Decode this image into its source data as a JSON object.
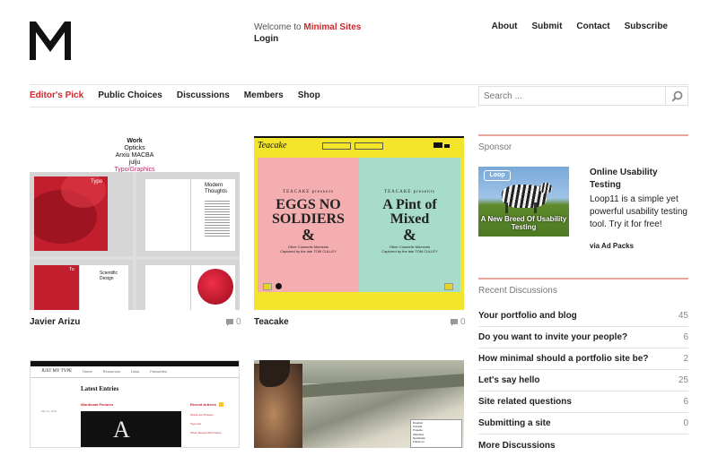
{
  "header": {
    "welcome_prefix": "Welcome to",
    "brand": "Minimal Sites",
    "login": "Login",
    "topnav": [
      "About",
      "Submit",
      "Contact",
      "Subscribe"
    ]
  },
  "mainnav": [
    "Editor's Pick",
    "Public Choices",
    "Discussions",
    "Members",
    "Shop"
  ],
  "search": {
    "placeholder": "Search ..."
  },
  "sites": [
    {
      "title": "Javier Arizu",
      "comments": "0",
      "preview_lines": [
        "Work",
        "Opticks",
        "Arxiu MACBA",
        "julju",
        "Typo/Graphics"
      ],
      "preview_panels": [
        "Typo",
        "Modern Thoughts",
        "Tu",
        "Scientific Design"
      ]
    },
    {
      "title": "Teacake",
      "comments": "0",
      "preview_logo": "Teacake",
      "preview_left": {
        "kicker": "TEACAKE presents",
        "title": "EGGS NO SOLDIERS",
        "amp": "&",
        "sub1": "Other Cosmetic Moments",
        "sub2": "Captured by the late TOM CULLEY"
      },
      "preview_right": {
        "kicker": "TEACAKE presents",
        "title": "A Pint of Mixed",
        "amp": "&",
        "sub1": "Other Cosmetic Moments",
        "sub2": "Captured by the late TOM CULLEY"
      }
    },
    {
      "title": "",
      "preview_brand": "JUST MY TYPE",
      "preview_heading": "Latest Entries",
      "preview_tabs": [
        "Home",
        "Resources",
        "Links",
        "Favourites"
      ],
      "preview_post": "Wordicam Pictures",
      "preview_post_date": "Mar 11, 2011",
      "preview_side_head": "Recent Articles",
      "preview_side_items": [
        "Words are Pictures",
        "Type Cut",
        "Other Stamps Who Cares"
      ]
    },
    {
      "title": "",
      "preview_menu": [
        "Dreipfeil",
        "Kontakt",
        "Projekte",
        "Websites",
        "Newsletter",
        "Follow us"
      ]
    }
  ],
  "sidebar": {
    "sponsor_heading": "Sponsor",
    "ad": {
      "image_brand": "Loop",
      "image_caption": "A New Breed Of Usability Testing",
      "title": "Online Usability Testing",
      "text": "Loop11 is a simple yet powerful usability testing tool. Try it for free!",
      "via": "via Ad Packs"
    },
    "discussions_heading": "Recent Discussions",
    "discussions": [
      {
        "title": "Your portfolio and blog",
        "count": "45"
      },
      {
        "title": "Do you want to invite your people?",
        "count": "6"
      },
      {
        "title": "How minimal should a portfolio site be?",
        "count": "2"
      },
      {
        "title": "Let's say hello",
        "count": "25"
      },
      {
        "title": "Site related questions",
        "count": "6"
      },
      {
        "title": "Submitting a site",
        "count": "0"
      },
      {
        "title": "More Discussions",
        "count": ""
      }
    ]
  },
  "colors": {
    "accent": "#d0262a",
    "teacake_yellow": "#f3e52a",
    "teacake_pink": "#f4aeb0",
    "teacake_mint": "#a6dcc9"
  }
}
